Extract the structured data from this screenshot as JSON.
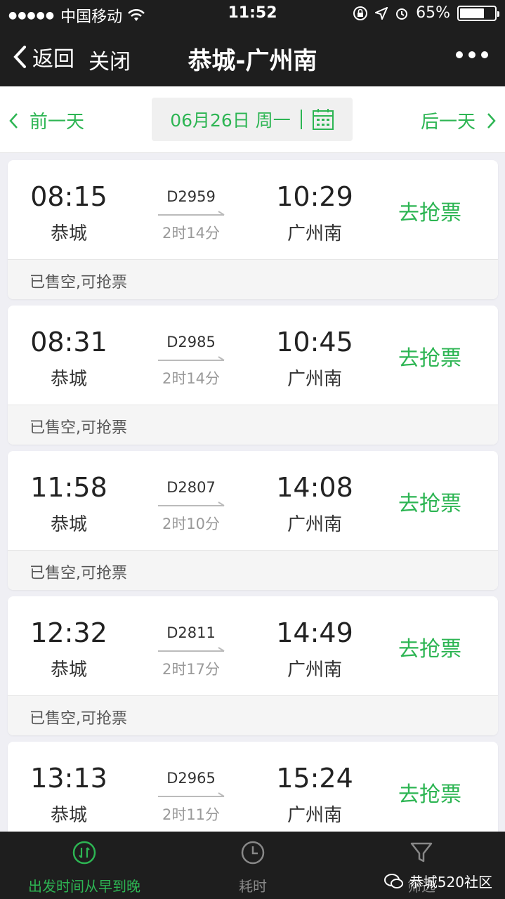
{
  "status": {
    "carrier": "中国移动",
    "time": "11:52",
    "battery": "65%",
    "battery_level": 0.65
  },
  "nav": {
    "back": "返回",
    "close": "关闭",
    "title": "恭城-广州南"
  },
  "datebar": {
    "prev": "前一天",
    "date": "06月26日 周一",
    "next": "后一天"
  },
  "trains": [
    {
      "dep_time": "08:15",
      "dep_station": "恭城",
      "train_no": "D2959",
      "duration": "2时14分",
      "arr_time": "10:29",
      "arr_station": "广州南",
      "action": "去抢票",
      "status": "已售空,可抢票"
    },
    {
      "dep_time": "08:31",
      "dep_station": "恭城",
      "train_no": "D2985",
      "duration": "2时14分",
      "arr_time": "10:45",
      "arr_station": "广州南",
      "action": "去抢票",
      "status": "已售空,可抢票"
    },
    {
      "dep_time": "11:58",
      "dep_station": "恭城",
      "train_no": "D2807",
      "duration": "2时10分",
      "arr_time": "14:08",
      "arr_station": "广州南",
      "action": "去抢票",
      "status": "已售空,可抢票"
    },
    {
      "dep_time": "12:32",
      "dep_station": "恭城",
      "train_no": "D2811",
      "duration": "2时17分",
      "arr_time": "14:49",
      "arr_station": "广州南",
      "action": "去抢票",
      "status": "已售空,可抢票"
    },
    {
      "dep_time": "13:13",
      "dep_station": "恭城",
      "train_no": "D2965",
      "duration": "2时11分",
      "arr_time": "15:24",
      "arr_station": "广州南",
      "action": "去抢票",
      "status": ""
    }
  ],
  "tabs": {
    "sort": "出发时间从早到晚",
    "duration": "耗时",
    "filter": "筛选"
  },
  "watermark": "恭城520社区",
  "colors": {
    "accent": "#2db553",
    "dark_bar": "#1e1e1e"
  }
}
